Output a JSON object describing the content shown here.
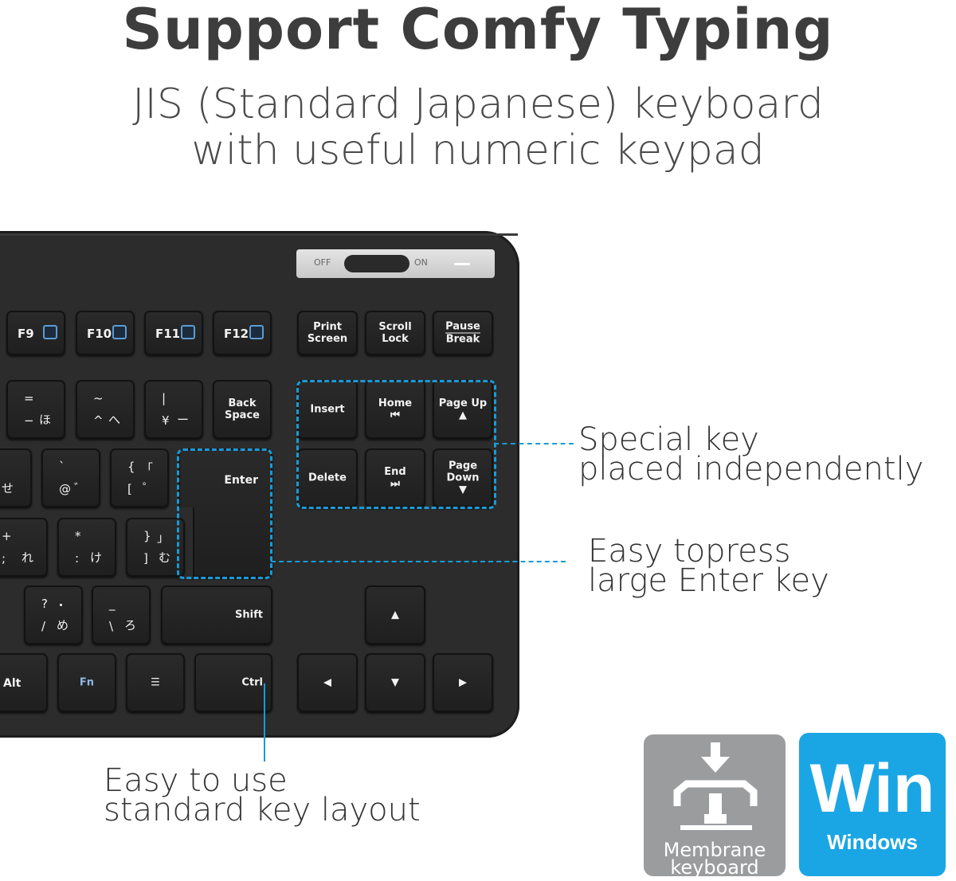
{
  "header": {
    "title": "Support Comfy Typing",
    "subtitle_line1": "JIS (Standard Japanese) keyboard",
    "subtitle_line2": "with useful numeric keypad"
  },
  "switch": {
    "off": "OFF",
    "on": "ON"
  },
  "keys": {
    "f9": "F9",
    "f10": "F10",
    "f11": "F11",
    "f12": "F12",
    "print": "Print Screen",
    "scroll": "Scroll Lock",
    "pause": "Pause",
    "brk": "Break",
    "eq": {
      "tl": "=",
      "bl": "−",
      "br": "ほ"
    },
    "tilde": {
      "tl": "~",
      "bl": "^",
      "br": "へ"
    },
    "pipe": {
      "tl": "|",
      "bl": "¥",
      "br": "ー"
    },
    "backspace": "Back Space",
    "insert": "Insert",
    "home": "Home",
    "home_sym": "⏮",
    "pgup": "Page Up",
    "pgup_sym": "▲",
    "se": {
      "bl": "せ"
    },
    "at": {
      "tl": "`",
      "bl": "@",
      "br": "゛"
    },
    "brace": {
      "tl": "{",
      "tr": "「",
      "bl": "[",
      "br": "゜"
    },
    "enter": "Enter",
    "delete": "Delete",
    "end": "End",
    "end_sym": "⏭",
    "pgdn": "Page Down",
    "pgdn_sym": "▼",
    "plus": {
      "tl": "+",
      "bl": ";",
      "br": "れ"
    },
    "star": {
      "tl": "*",
      "bl": ":",
      "br": "け"
    },
    "rbrace": {
      "tl": "}",
      "tr": "」",
      "bl": "]",
      "br": "む"
    },
    "q": {
      "tl": "?",
      "tr": "・",
      "bl": "/",
      "br": "め"
    },
    "bs": {
      "tl": "_",
      "bl": "\\",
      "br": "ろ"
    },
    "shift": "Shift",
    "up": "▲",
    "alt": "Alt",
    "fn": "Fn",
    "menu": "☰",
    "ctrl": "Ctrl",
    "left": "◀",
    "down": "▼",
    "right": "▶"
  },
  "callouts": {
    "special_1": "Special key",
    "special_2": "placed independently",
    "enter_1": "Easy topress",
    "enter_2": "large Enter key",
    "layout_1": "Easy to use",
    "layout_2": "standard key layout"
  },
  "badges": {
    "membrane_1": "Membrane",
    "membrane_2": "keyboard",
    "win": "Win",
    "windows": "Windows"
  },
  "colors": {
    "accent": "#1a9ad6",
    "win_badge": "#1aa6e4",
    "membrane_badge": "#9b9c9e",
    "keyboard": "#2c2c2c"
  }
}
